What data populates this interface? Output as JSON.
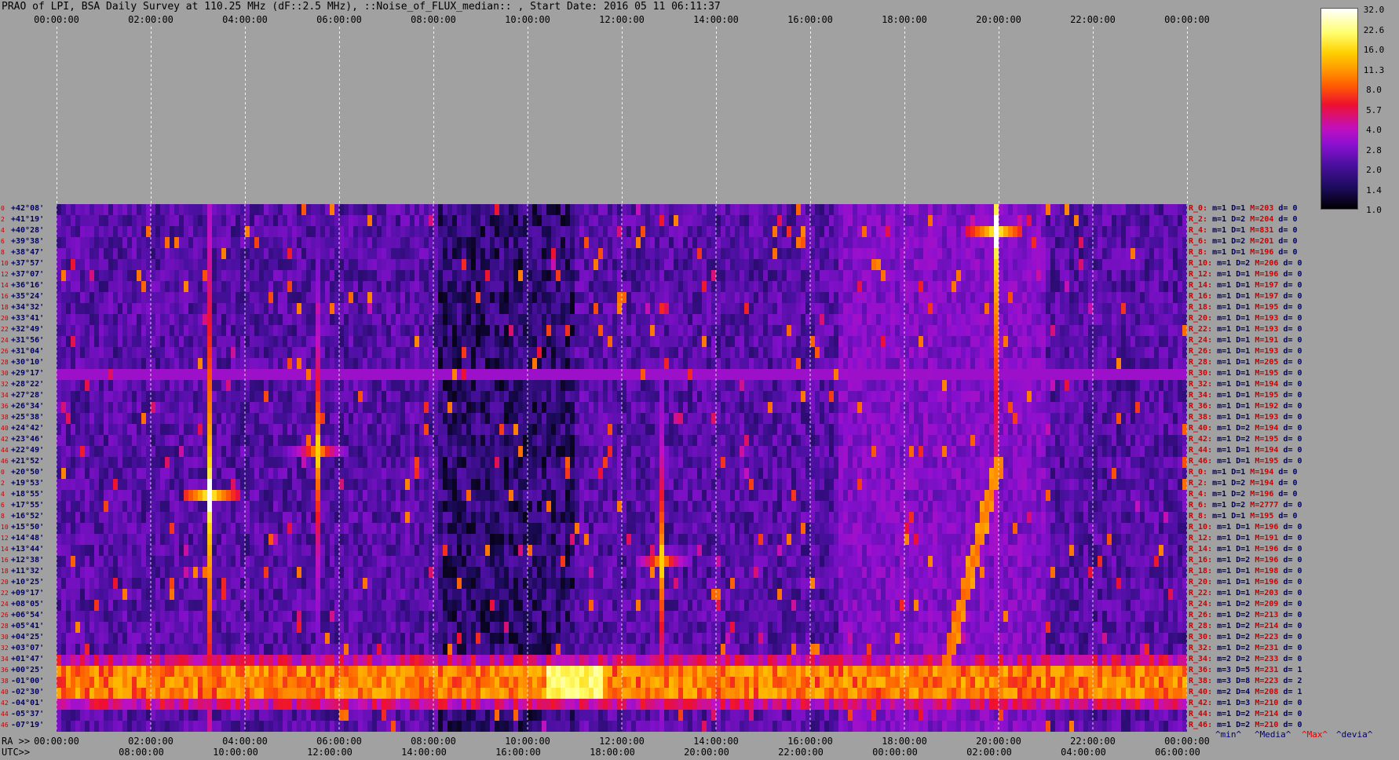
{
  "title": "PRAO of LPI, BSA Daily Survey at 110.25 MHz (dF::2.5 MHz), ::Noise_of_FLUX_median:: , Start Date: 2016 05 11 06:11:37",
  "ra_label": "RA >>",
  "utc_label": "UTC>>",
  "top_ticks": [
    "00:00:00",
    "02:00:00",
    "04:00:00",
    "06:00:00",
    "08:00:00",
    "10:00:00",
    "12:00:00",
    "14:00:00",
    "16:00:00",
    "18:00:00",
    "20:00:00",
    "22:00:00",
    "00:00:00"
  ],
  "bottom_ra_ticks": [
    "00:00:00",
    "02:00:00",
    "04:00:00",
    "06:00:00",
    "08:00:00",
    "10:00:00",
    "12:00:00",
    "14:00:00",
    "16:00:00",
    "18:00:00",
    "20:00:00",
    "22:00:00",
    "00:00:00"
  ],
  "bottom_utc_ticks": [
    "08:00:00",
    "10:00:00",
    "12:00:00",
    "14:00:00",
    "16:00:00",
    "18:00:00",
    "20:00:00",
    "22:00:00",
    "00:00:00",
    "02:00:00",
    "04:00:00",
    "06:00:00"
  ],
  "dec_labels": [
    "+42°08'",
    "+41°19'",
    "+40°28'",
    "+39°38'",
    "+38°47'",
    "+37°57'",
    "+37°07'",
    "+36°16'",
    "+35°24'",
    "+34°32'",
    "+33°41'",
    "+32°49'",
    "+31°56'",
    "+31°04'",
    "+30°10'",
    "+29°17'",
    "+28°22'",
    "+27°28'",
    "+26°34'",
    "+25°38'",
    "+24°42'",
    "+23°46'",
    "+22°49'",
    "+21°52'",
    "+20°50'",
    "+19°53'",
    "+18°55'",
    "+17°55'",
    "+16°52'",
    "+15°50'",
    "+14°48'",
    "+13°44'",
    "+12°38'",
    "+11°32'",
    "+10°25'",
    "+09°17'",
    "+08°05'",
    "+06°54'",
    "+05°41'",
    "+04°25'",
    "+03°07'",
    "+01°47'",
    "+00°25'",
    "-01°00'",
    "-02°30'",
    "-04°01'",
    "-05°37'",
    "-07°19'"
  ],
  "row_index_labels": [
    "0",
    "2",
    "4",
    "6",
    "8",
    "10",
    "12",
    "14",
    "16",
    "18",
    "20",
    "22",
    "24",
    "26",
    "28",
    "30",
    "32",
    "34",
    "36",
    "38",
    "40",
    "42",
    "44",
    "46",
    "0",
    "2",
    "4",
    "6",
    "8",
    "10",
    "12",
    "14",
    "16",
    "18",
    "20",
    "22",
    "24",
    "26",
    "28",
    "30",
    "32",
    "34",
    "36",
    "38",
    "40",
    "42",
    "44",
    "46"
  ],
  "stats": [
    {
      "r": "R_0:",
      "m": "1",
      "D": "1",
      "M": "203",
      "d": "0"
    },
    {
      "r": "R_2:",
      "m": "1",
      "D": "2",
      "M": "204",
      "d": "0"
    },
    {
      "r": "R_4:",
      "m": "1",
      "D": "1",
      "M": "831",
      "d": "0"
    },
    {
      "r": "R_6:",
      "m": "1",
      "D": "2",
      "M": "201",
      "d": "0"
    },
    {
      "r": "R_8:",
      "m": "1",
      "D": "1",
      "M": "196",
      "d": "0"
    },
    {
      "r": "R_10:",
      "m": "1",
      "D": "2",
      "M": "206",
      "d": "0"
    },
    {
      "r": "R_12:",
      "m": "1",
      "D": "1",
      "M": "196",
      "d": "0"
    },
    {
      "r": "R_14:",
      "m": "1",
      "D": "1",
      "M": "197",
      "d": "0"
    },
    {
      "r": "R_16:",
      "m": "1",
      "D": "1",
      "M": "197",
      "d": "0"
    },
    {
      "r": "R_18:",
      "m": "1",
      "D": "1",
      "M": "195",
      "d": "0"
    },
    {
      "r": "R_20:",
      "m": "1",
      "D": "1",
      "M": "193",
      "d": "0"
    },
    {
      "r": "R_22:",
      "m": "1",
      "D": "1",
      "M": "193",
      "d": "0"
    },
    {
      "r": "R_24:",
      "m": "1",
      "D": "1",
      "M": "191",
      "d": "0"
    },
    {
      "r": "R_26:",
      "m": "1",
      "D": "1",
      "M": "193",
      "d": "0"
    },
    {
      "r": "R_28:",
      "m": "1",
      "D": "1",
      "M": "205",
      "d": "0"
    },
    {
      "r": "R_30:",
      "m": "1",
      "D": "1",
      "M": "195",
      "d": "0"
    },
    {
      "r": "R_32:",
      "m": "1",
      "D": "1",
      "M": "194",
      "d": "0"
    },
    {
      "r": "R_34:",
      "m": "1",
      "D": "1",
      "M": "195",
      "d": "0"
    },
    {
      "r": "R_36:",
      "m": "1",
      "D": "1",
      "M": "192",
      "d": "0"
    },
    {
      "r": "R_38:",
      "m": "1",
      "D": "1",
      "M": "193",
      "d": "0"
    },
    {
      "r": "R_40:",
      "m": "1",
      "D": "2",
      "M": "194",
      "d": "0"
    },
    {
      "r": "R_42:",
      "m": "1",
      "D": "2",
      "M": "195",
      "d": "0"
    },
    {
      "r": "R_44:",
      "m": "1",
      "D": "1",
      "M": "194",
      "d": "0"
    },
    {
      "r": "R_46:",
      "m": "1",
      "D": "1",
      "M": "195",
      "d": "0"
    },
    {
      "r": "R_0:",
      "m": "1",
      "D": "1",
      "M": "194",
      "d": "0"
    },
    {
      "r": "R_2:",
      "m": "1",
      "D": "2",
      "M": "194",
      "d": "0"
    },
    {
      "r": "R_4:",
      "m": "1",
      "D": "2",
      "M": "196",
      "d": "0"
    },
    {
      "r": "R_6:",
      "m": "1",
      "D": "2",
      "M": "2777",
      "d": "0"
    },
    {
      "r": "R_8:",
      "m": "1",
      "D": "1",
      "M": "195",
      "d": "0"
    },
    {
      "r": "R_10:",
      "m": "1",
      "D": "1",
      "M": "196",
      "d": "0"
    },
    {
      "r": "R_12:",
      "m": "1",
      "D": "1",
      "M": "191",
      "d": "0"
    },
    {
      "r": "R_14:",
      "m": "1",
      "D": "1",
      "M": "196",
      "d": "0"
    },
    {
      "r": "R_16:",
      "m": "1",
      "D": "2",
      "M": "196",
      "d": "0"
    },
    {
      "r": "R_18:",
      "m": "1",
      "D": "1",
      "M": "198",
      "d": "0"
    },
    {
      "r": "R_20:",
      "m": "1",
      "D": "1",
      "M": "196",
      "d": "0"
    },
    {
      "r": "R_22:",
      "m": "1",
      "D": "1",
      "M": "203",
      "d": "0"
    },
    {
      "r": "R_24:",
      "m": "1",
      "D": "2",
      "M": "209",
      "d": "0"
    },
    {
      "r": "R_26:",
      "m": "1",
      "D": "2",
      "M": "213",
      "d": "0"
    },
    {
      "r": "R_28:",
      "m": "1",
      "D": "2",
      "M": "214",
      "d": "0"
    },
    {
      "r": "R_30:",
      "m": "1",
      "D": "2",
      "M": "223",
      "d": "0"
    },
    {
      "r": "R_32:",
      "m": "1",
      "D": "2",
      "M": "231",
      "d": "0"
    },
    {
      "r": "R_34:",
      "m": "2",
      "D": "2",
      "M": "233",
      "d": "0"
    },
    {
      "r": "R_36:",
      "m": "3",
      "D": "5",
      "M": "231",
      "d": "1"
    },
    {
      "r": "R_38:",
      "m": "3",
      "D": "8",
      "M": "223",
      "d": "2"
    },
    {
      "r": "R_40:",
      "m": "2",
      "D": "4",
      "M": "208",
      "d": "1"
    },
    {
      "r": "R_42:",
      "m": "1",
      "D": "3",
      "M": "210",
      "d": "0"
    },
    {
      "r": "R_44:",
      "m": "1",
      "D": "2",
      "M": "214",
      "d": "0"
    },
    {
      "r": "R_46:",
      "m": "1",
      "D": "2",
      "M": "210",
      "d": "0"
    }
  ],
  "legend": {
    "min": "^min^",
    "median": "^Media^",
    "max": "^Max^",
    "devia": "^devia^"
  },
  "colorbar": {
    "ticks": [
      "32.0",
      "22.6",
      "16.0",
      "11.3",
      "8.0",
      "5.7",
      "4.0",
      "2.8",
      "2.0",
      "1.4",
      "1.0"
    ]
  },
  "chart_data": {
    "type": "heatmap",
    "x_ra_range": [
      "00:00:00",
      "24:00:00"
    ],
    "x_utc_range": [
      "06:11:37",
      "06:11:37 (+1 day)"
    ],
    "y_range": [
      "+42°08'",
      "-07°19'"
    ],
    "value_scale": "log",
    "value_range": [
      1.0,
      32.0
    ],
    "colormap": [
      "#000000",
      "#1a0a58",
      "#4a10a0",
      "#8a10d0",
      "#c010c0",
      "#ee1030",
      "#ff6000",
      "#ff9c00",
      "#ffd000",
      "#ffff70",
      "#ffffff"
    ],
    "sources": [
      {
        "ra_h": 3.2,
        "row": 26,
        "intensity": 32
      },
      {
        "ra_h": 19.9,
        "row": 2,
        "intensity": 32
      },
      {
        "ra_h": 12.8,
        "row": 32,
        "intensity": 16
      },
      {
        "ra_h": 5.5,
        "row": 22,
        "intensity": 16
      }
    ],
    "hot_band_rows": [
      42,
      43,
      44
    ],
    "horizontal_stripe_row": 14.7
  }
}
